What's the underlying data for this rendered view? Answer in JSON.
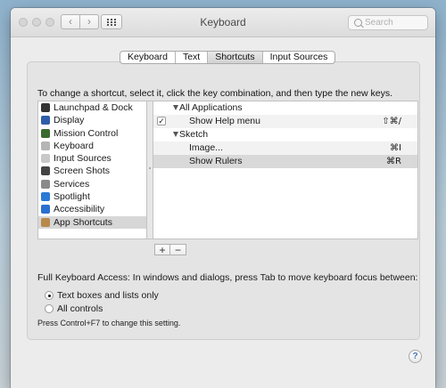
{
  "window": {
    "title": "Keyboard"
  },
  "toolbar": {
    "back_icon": "‹",
    "forward_icon": "›",
    "search_placeholder": "Search"
  },
  "tabs": [
    {
      "label": "Keyboard",
      "active": false
    },
    {
      "label": "Text",
      "active": false
    },
    {
      "label": "Shortcuts",
      "active": true
    },
    {
      "label": "Input Sources",
      "active": false
    }
  ],
  "instructions": "To change a shortcut, select it, click the key combination, and then type the new keys.",
  "categories": [
    {
      "label": "Launchpad & Dock",
      "icon": "launchpad-icon",
      "color": "#333333"
    },
    {
      "label": "Display",
      "icon": "display-icon",
      "color": "#2f5ea8"
    },
    {
      "label": "Mission Control",
      "icon": "mission-control-icon",
      "color": "#3a6b2e"
    },
    {
      "label": "Keyboard",
      "icon": "keyboard-icon",
      "color": "#b5b5b5"
    },
    {
      "label": "Input Sources",
      "icon": "input-sources-icon",
      "color": "#c8c8c8"
    },
    {
      "label": "Screen Shots",
      "icon": "screen-shots-icon",
      "color": "#444444"
    },
    {
      "label": "Services",
      "icon": "services-icon",
      "color": "#8a8a8a"
    },
    {
      "label": "Spotlight",
      "icon": "spotlight-icon",
      "color": "#2a7ad6"
    },
    {
      "label": "Accessibility",
      "icon": "accessibility-icon",
      "color": "#2b6fd0"
    },
    {
      "label": "App Shortcuts",
      "icon": "app-shortcuts-icon",
      "color": "#b88a4a",
      "selected": true
    }
  ],
  "shortcuts": [
    {
      "type": "group",
      "label": "All Applications"
    },
    {
      "type": "item",
      "label": "Show Help menu",
      "keys": "⇧⌘/",
      "checked": true,
      "checkmark": "✓"
    },
    {
      "type": "group",
      "label": "Sketch"
    },
    {
      "type": "item",
      "label": "Image...",
      "keys": "⌘I"
    },
    {
      "type": "item",
      "label": "Show Rulers",
      "keys": "⌘R",
      "selected": true
    }
  ],
  "buttons": {
    "add": "+",
    "remove": "−",
    "help": "?"
  },
  "full_keyboard_access": {
    "label": "Full Keyboard Access: In windows and dialogs, press Tab to move keyboard focus between:",
    "options": [
      {
        "label": "Text boxes and lists only",
        "selected": true
      },
      {
        "label": "All controls",
        "selected": false
      }
    ],
    "hint": "Press Control+F7 to change this setting."
  }
}
